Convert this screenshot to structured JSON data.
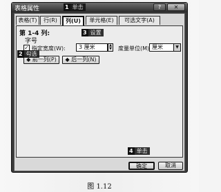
{
  "dialog": {
    "title": "表格属性",
    "help_label": "?",
    "close_label": "✕",
    "tabs": [
      {
        "label": "表格(T)"
      },
      {
        "label": "行(R)"
      },
      {
        "label": "列(U)"
      },
      {
        "label": "单元格(E)"
      },
      {
        "label": "可选文字(A)"
      }
    ],
    "active_tab": "列(U)",
    "column": {
      "heading": "第 1-4 列:",
      "subheading": "字号",
      "specify_width_checked": true,
      "specify_width_label": "指定宽度(W):",
      "width_value": "3 厘米",
      "unit_label": "度量单位(M):",
      "unit_value": "厘米",
      "prev_column_label": "◆ 前一列(P)",
      "next_column_label": "◆ 后一列(N)"
    },
    "ok_label": "确定",
    "cancel_label": "取消"
  },
  "markers": [
    {
      "number": "1",
      "text": "单击"
    },
    {
      "number": "2",
      "text": "勾选"
    },
    {
      "number": "3",
      "text": "设置"
    },
    {
      "number": "4",
      "text": "单击"
    }
  ],
  "caption": "图 1.12"
}
